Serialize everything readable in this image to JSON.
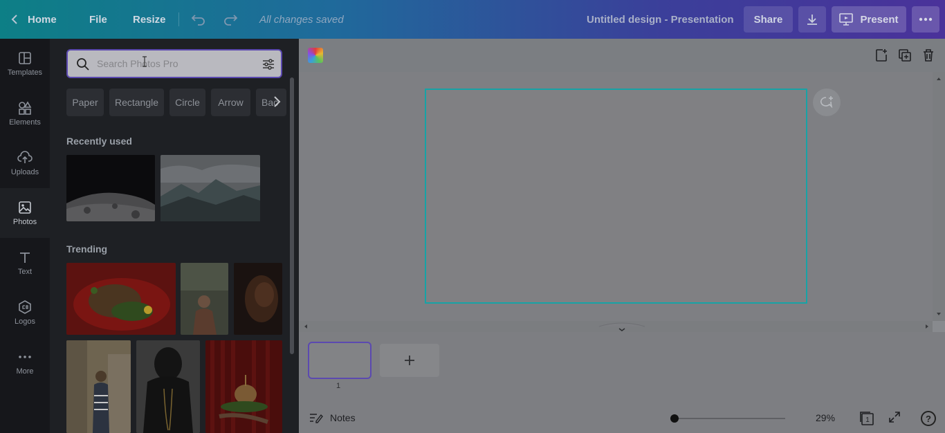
{
  "topbar": {
    "home_label": "Home",
    "file_label": "File",
    "resize_label": "Resize",
    "status": "All changes saved",
    "design_title": "Untitled design - Presentation",
    "share_label": "Share",
    "present_label": "Present"
  },
  "rail": {
    "items": [
      {
        "label": "Templates",
        "icon": "templates-icon"
      },
      {
        "label": "Elements",
        "icon": "elements-icon"
      },
      {
        "label": "Uploads",
        "icon": "upload-icon"
      },
      {
        "label": "Photos",
        "icon": "photos-icon",
        "active": true
      },
      {
        "label": "Text",
        "icon": "text-icon"
      },
      {
        "label": "Logos",
        "icon": "logos-icon"
      },
      {
        "label": "More",
        "icon": "more-dots-icon"
      }
    ]
  },
  "panel": {
    "search_placeholder": "Search Photos Pro",
    "chips": [
      "Paper",
      "Rectangle",
      "Circle",
      "Arrow",
      "Bac"
    ],
    "recently_used_title": "Recently used",
    "trending_title": "Trending"
  },
  "pages": {
    "page_number": "1"
  },
  "footer": {
    "notes_label": "Notes",
    "zoom": "29%",
    "page_count": "1",
    "help_label": "?"
  },
  "colors": {
    "accent": "#5b49b0",
    "page_border": "#16a3a6"
  }
}
